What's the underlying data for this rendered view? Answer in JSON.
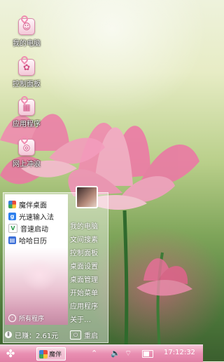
{
  "desktop": {
    "icons": [
      {
        "label": "我的电脑",
        "icon": "cat-computer-icon"
      },
      {
        "label": "控制面板",
        "icon": "flower-control-panel-icon"
      },
      {
        "label": "应用程序",
        "icon": "apps-icon"
      },
      {
        "label": "网上冲浪",
        "icon": "globe-icon"
      }
    ]
  },
  "start_menu": {
    "left_items": [
      {
        "label": "魔伴桌面",
        "icon": "mobanzhuomian-icon",
        "color": "#3b82d8"
      },
      {
        "label": "光速输入法",
        "icon": "input-method-icon",
        "color": "#2f80ed"
      },
      {
        "label": "音速启动",
        "icon": "v-launcher-icon",
        "color": "#2e9b4f"
      },
      {
        "label": "哈哈日历",
        "icon": "calendar-icon",
        "color": "#3b6fd8"
      }
    ],
    "all_programs": "所有程序",
    "right_items": [
      "我的电脑",
      "文间搜素",
      "控制面板",
      "桌面设置",
      "桌面管理",
      "开始菜单",
      "应用程序",
      "关于…"
    ],
    "disk_free": "已赚：2.61元",
    "restart": "重启"
  },
  "taskbar": {
    "task_label": "魔伴",
    "clock": "17:12:32",
    "accent": "#e07fa5"
  }
}
